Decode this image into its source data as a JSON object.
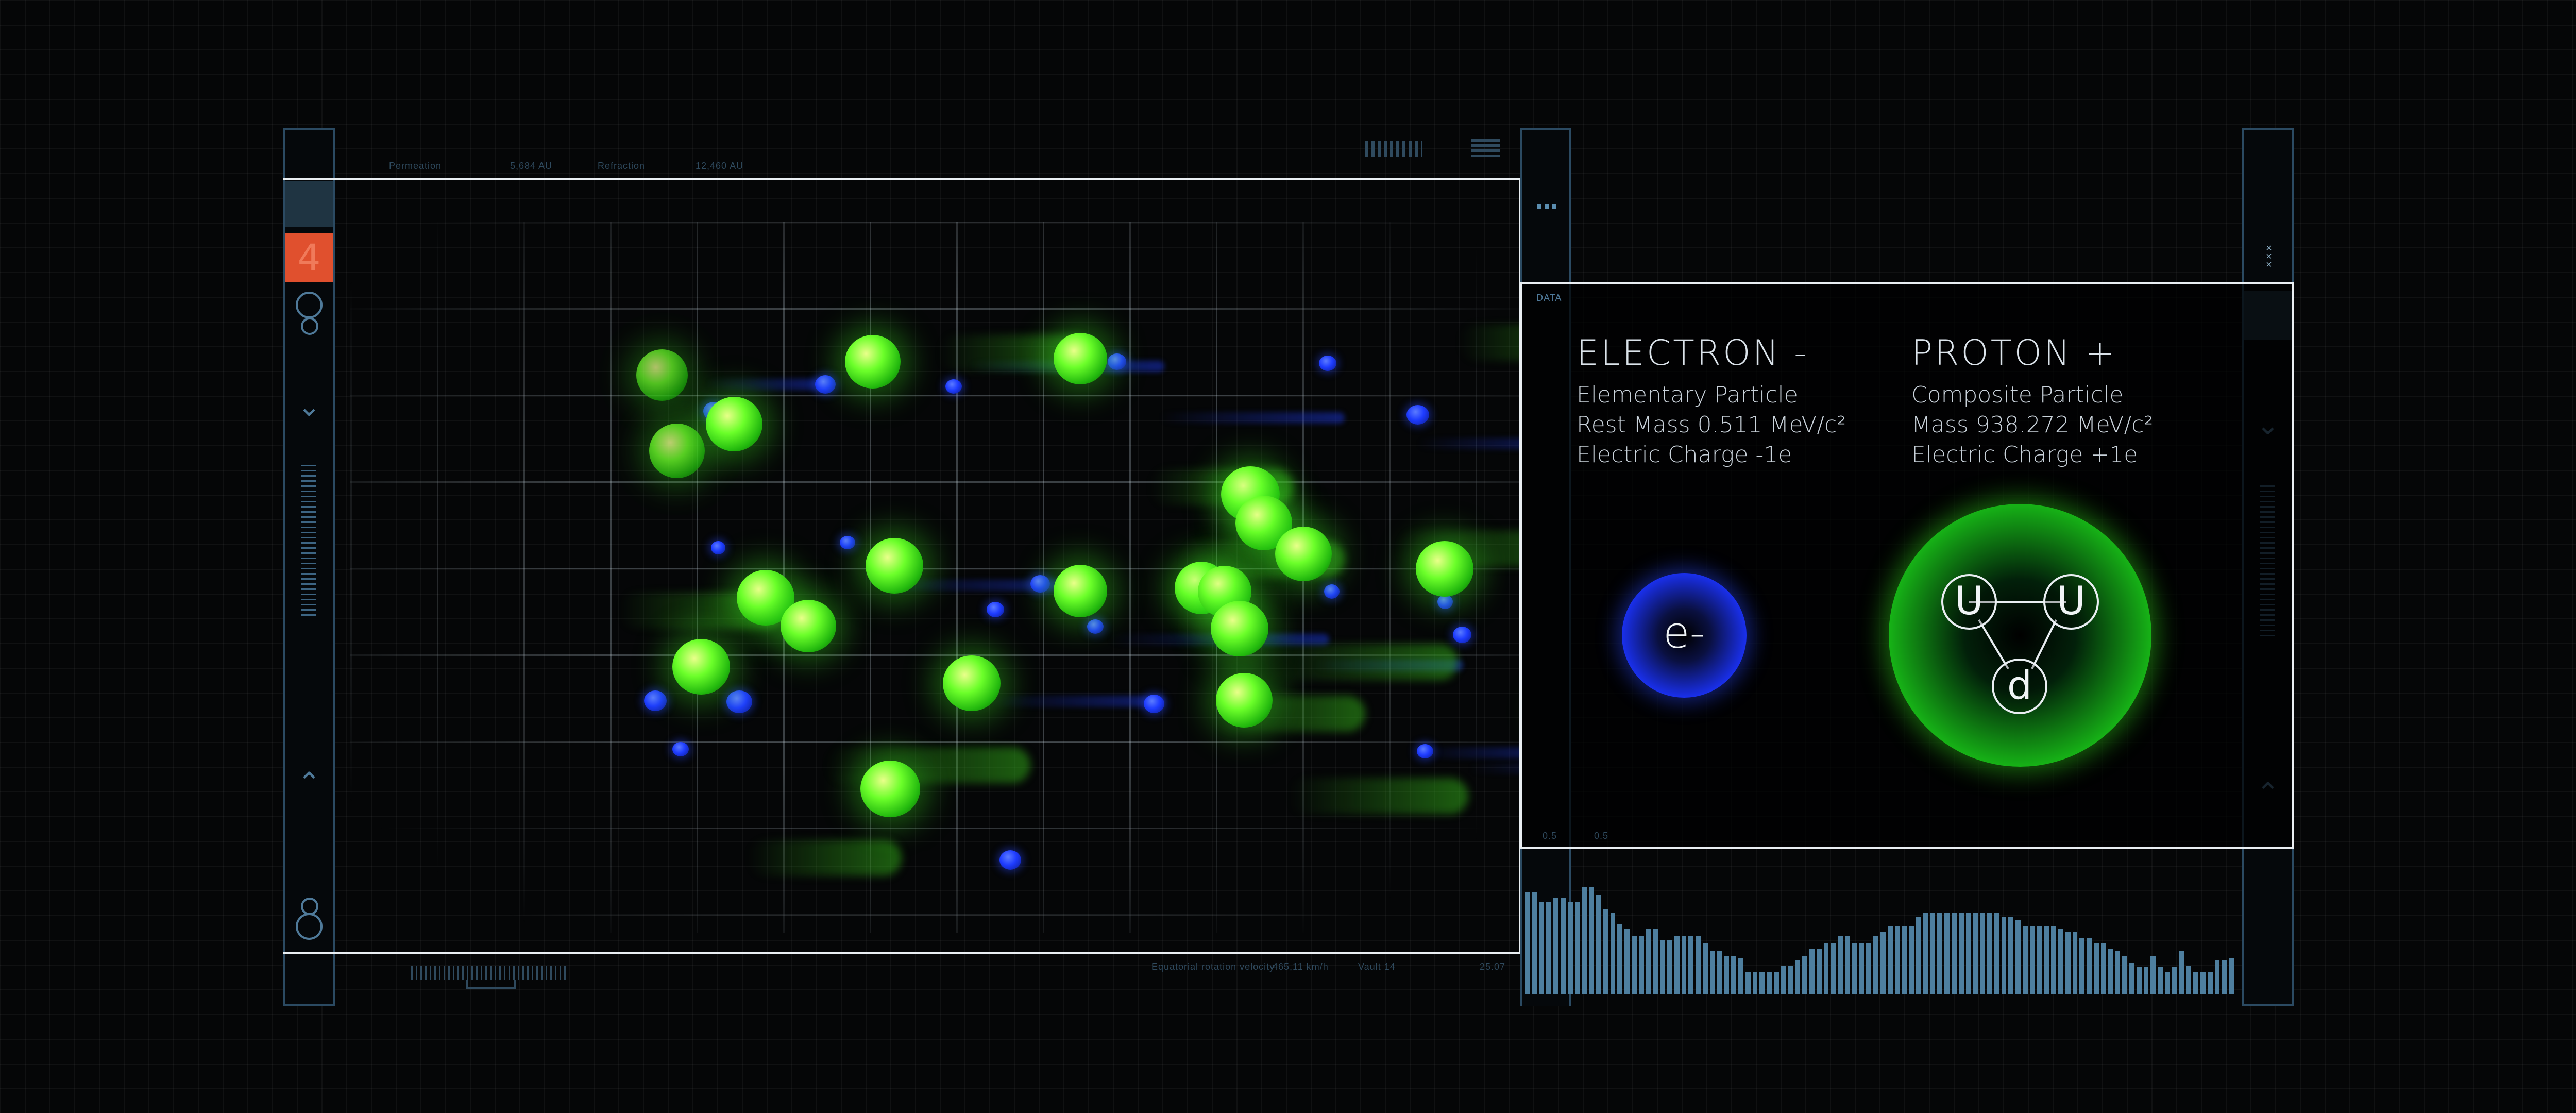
{
  "top_labels": [
    "Permeation",
    "5,684 AU",
    "Refraction",
    "12,460 AU"
  ],
  "bottom_labels": [
    "Equatorial rotation velocity",
    "465,11 km/h",
    "Vault 14",
    "25.07"
  ],
  "left_rail": {
    "counter": "4"
  },
  "data_tag": "DATA",
  "electron": {
    "title": "ELECTRON -",
    "kind": "Elementary Particle",
    "mass": "Rest Mass 0.511 MeV/c²",
    "charge": "Electric Charge -1e",
    "symbol": "e-"
  },
  "proton": {
    "title": "PROTON +",
    "kind": "Composite Particle",
    "mass": "Mass 938.272 MeV/c²",
    "charge": "Electric Charge +1e",
    "quarks": [
      "U",
      "U",
      "d"
    ]
  },
  "scale_labels": [
    "0.5",
    "0.5"
  ],
  "colors": {
    "accent_orange": "#e0502e",
    "proton_green": "#3cff1e",
    "electron_blue": "#1e3cff",
    "frame_line": "#e9eef2",
    "rail_line": "#2b4a62"
  },
  "histogram": [
    0.9,
    0.9,
    0.82,
    0.82,
    0.85,
    0.85,
    0.82,
    0.82,
    0.95,
    0.95,
    0.88,
    0.75,
    0.72,
    0.62,
    0.58,
    0.52,
    0.52,
    0.58,
    0.58,
    0.48,
    0.48,
    0.52,
    0.52,
    0.52,
    0.52,
    0.45,
    0.38,
    0.38,
    0.34,
    0.34,
    0.32,
    0.2,
    0.2,
    0.2,
    0.2,
    0.2,
    0.25,
    0.25,
    0.3,
    0.34,
    0.4,
    0.4,
    0.45,
    0.45,
    0.52,
    0.52,
    0.45,
    0.45,
    0.45,
    0.52,
    0.55,
    0.6,
    0.6,
    0.6,
    0.6,
    0.68,
    0.72,
    0.72,
    0.72,
    0.72,
    0.72,
    0.72,
    0.72,
    0.72,
    0.72,
    0.72,
    0.72,
    0.68,
    0.68,
    0.66,
    0.6,
    0.6,
    0.6,
    0.6,
    0.6,
    0.58,
    0.55,
    0.55,
    0.5,
    0.5,
    0.45,
    0.45,
    0.4,
    0.38,
    0.34,
    0.28,
    0.24,
    0.24,
    0.34,
    0.24,
    0.2,
    0.24,
    0.38,
    0.25,
    0.2,
    0.2,
    0.2,
    0.3,
    0.3,
    0.32
  ]
}
